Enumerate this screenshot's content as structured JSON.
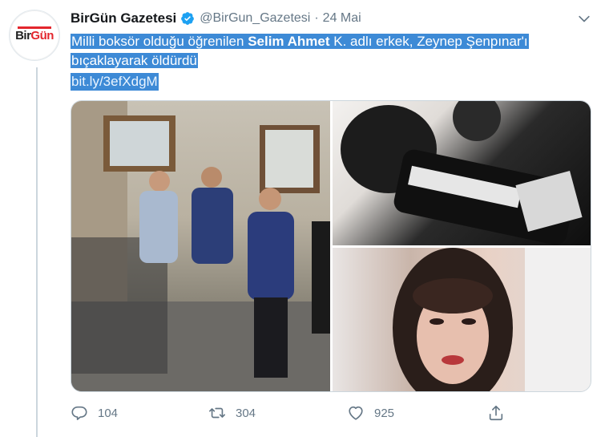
{
  "tweet": {
    "display_name": "BirGün Gazetesi",
    "handle": "@BirGun_Gazetesi",
    "separator": "·",
    "date": "24 Mai",
    "text_part1": "Milli boksör olduğu öğrenilen ",
    "text_bold": "Selim Ahmet",
    "text_part2": " K. adlı erkek, Zeynep Şenpınar'ı",
    "text_line2": "bıçaklayarak öldürdü",
    "link": "bit.ly/3efXdgM"
  },
  "avatar": {
    "logo_part1": "Bir",
    "logo_part2": "Gün"
  },
  "actions": {
    "replies": "104",
    "retweets": "304",
    "likes": "925"
  },
  "colors": {
    "accent": "#1b95e0",
    "selection": "#3d8ad6",
    "muted": "#657786",
    "logo_red": "#e3262d"
  },
  "icons": [
    "chevron-down-icon",
    "verified-badge-icon",
    "reply-icon",
    "retweet-icon",
    "like-icon",
    "share-icon"
  ]
}
